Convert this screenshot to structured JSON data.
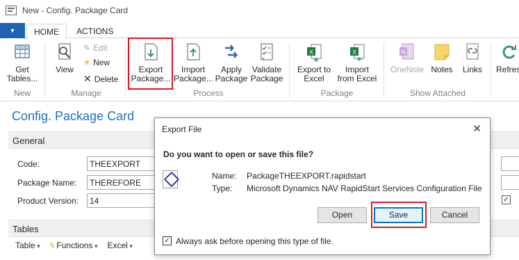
{
  "window": {
    "title": "New - Config. Package Card"
  },
  "tabs": [
    {
      "label": "HOME"
    },
    {
      "label": "ACTIONS"
    }
  ],
  "ribbon": {
    "get_tables": "Get Tables...",
    "view": "View",
    "edit": "Edit",
    "new": "New",
    "delete": "Delete",
    "export_package": "Export Package...",
    "import_package": "Import Package...",
    "apply_package": "Apply Package",
    "validate_package": "Validate Package",
    "export_excel": "Export to Excel",
    "import_excel": "Import from Excel",
    "onenote": "OneNote",
    "notes": "Notes",
    "links": "Links",
    "refresh": "Refres",
    "groups": {
      "new": "New",
      "manage": "Manage",
      "process": "Process",
      "package": "Package",
      "show_attached": "Show Attached"
    }
  },
  "page": {
    "title": "Config. Package Card",
    "general": "General",
    "code_label": "Code:",
    "code_value": "THEEXPORT",
    "package_name_label": "Package Name:",
    "package_name_value": "THEREFORE",
    "product_version_label": "Product Version:",
    "product_version_value": "14",
    "tables": "Tables",
    "toolbar": {
      "table": "Table",
      "functions": "Functions",
      "excel": "Excel"
    }
  },
  "dialog": {
    "title": "Export File",
    "close": "✕",
    "question": "Do you want to open or save this file?",
    "name_label": "Name:",
    "name_value": "PackageTHEEXPORT.rapidstart",
    "type_label": "Type:",
    "type_value": "Microsoft Dynamics NAV RapidStart Services Configuration File",
    "open": "Open",
    "save": "Save",
    "cancel": "Cancel",
    "always_ask": "Always ask before opening this type of file.",
    "always_ask_checked": true
  },
  "colors": {
    "accent": "#1f62b5",
    "title_blue": "#1f6fc5",
    "highlight_red": "#e81123"
  }
}
